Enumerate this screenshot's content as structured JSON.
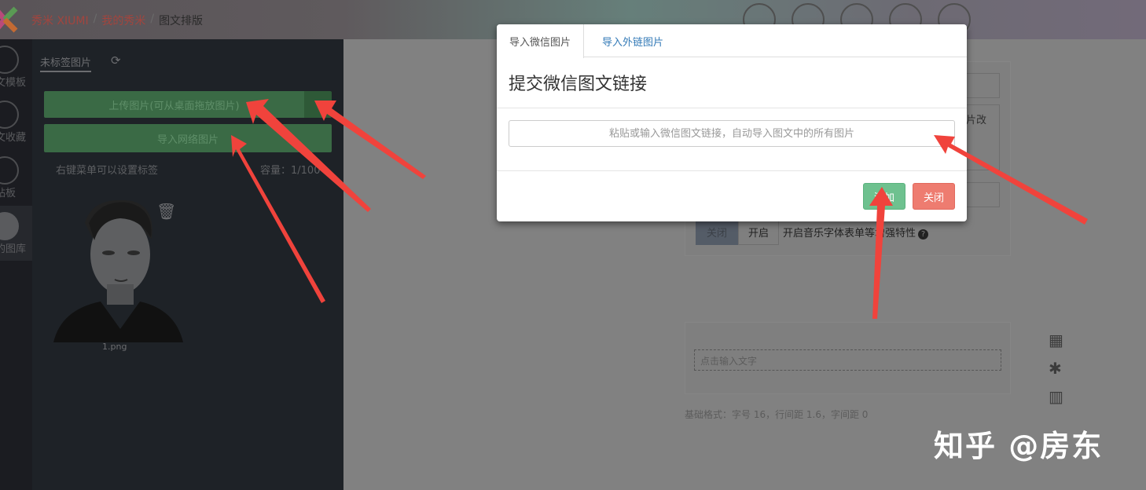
{
  "breadcrumb": {
    "items": [
      "秀米 XIUMI",
      "我的秀米",
      "图文排版"
    ],
    "separator": "/"
  },
  "sidebar_rail": {
    "items": [
      {
        "label": "文模板",
        "icon": "list-icon"
      },
      {
        "label": "文收藏",
        "icon": "bookmark-icon"
      },
      {
        "label": "贴板",
        "icon": "clipboard-icon"
      },
      {
        "label": "的图库",
        "icon": "image-gallery-icon",
        "active": true
      }
    ]
  },
  "library": {
    "tab_label": "未标签图片",
    "upload_label": "上传图片(可从桌面拖放图片)",
    "import_label": "导入网络图片",
    "hint": "右键菜单可以设置标签",
    "capacity": "容量：1/100",
    "images": [
      {
        "name": "1.png"
      }
    ]
  },
  "editor": {
    "side_text": "片改",
    "toggle_off": "关闭",
    "toggle_on": "开启",
    "music_label": "开启音乐字体表单等增强特性",
    "text_placeholder": "点击输入文字",
    "format_note": "基础格式：字号 16，行间距 1.6，字间距 0"
  },
  "modal": {
    "tabs": [
      "导入微信图片",
      "导入外链图片"
    ],
    "active_tab": 0,
    "title": "提交微信图文链接",
    "input_placeholder": "粘贴或输入微信图文链接，自动导入图文中的所有图片",
    "input_value": "",
    "add_label": "添加",
    "close_label": "关闭"
  },
  "watermark": "知乎 @房东",
  "colors": {
    "accent_green": "#6ec18f",
    "accent_red": "#ee7c70",
    "link_blue": "#337ab7",
    "annotation_arrow": "#f0433c"
  }
}
